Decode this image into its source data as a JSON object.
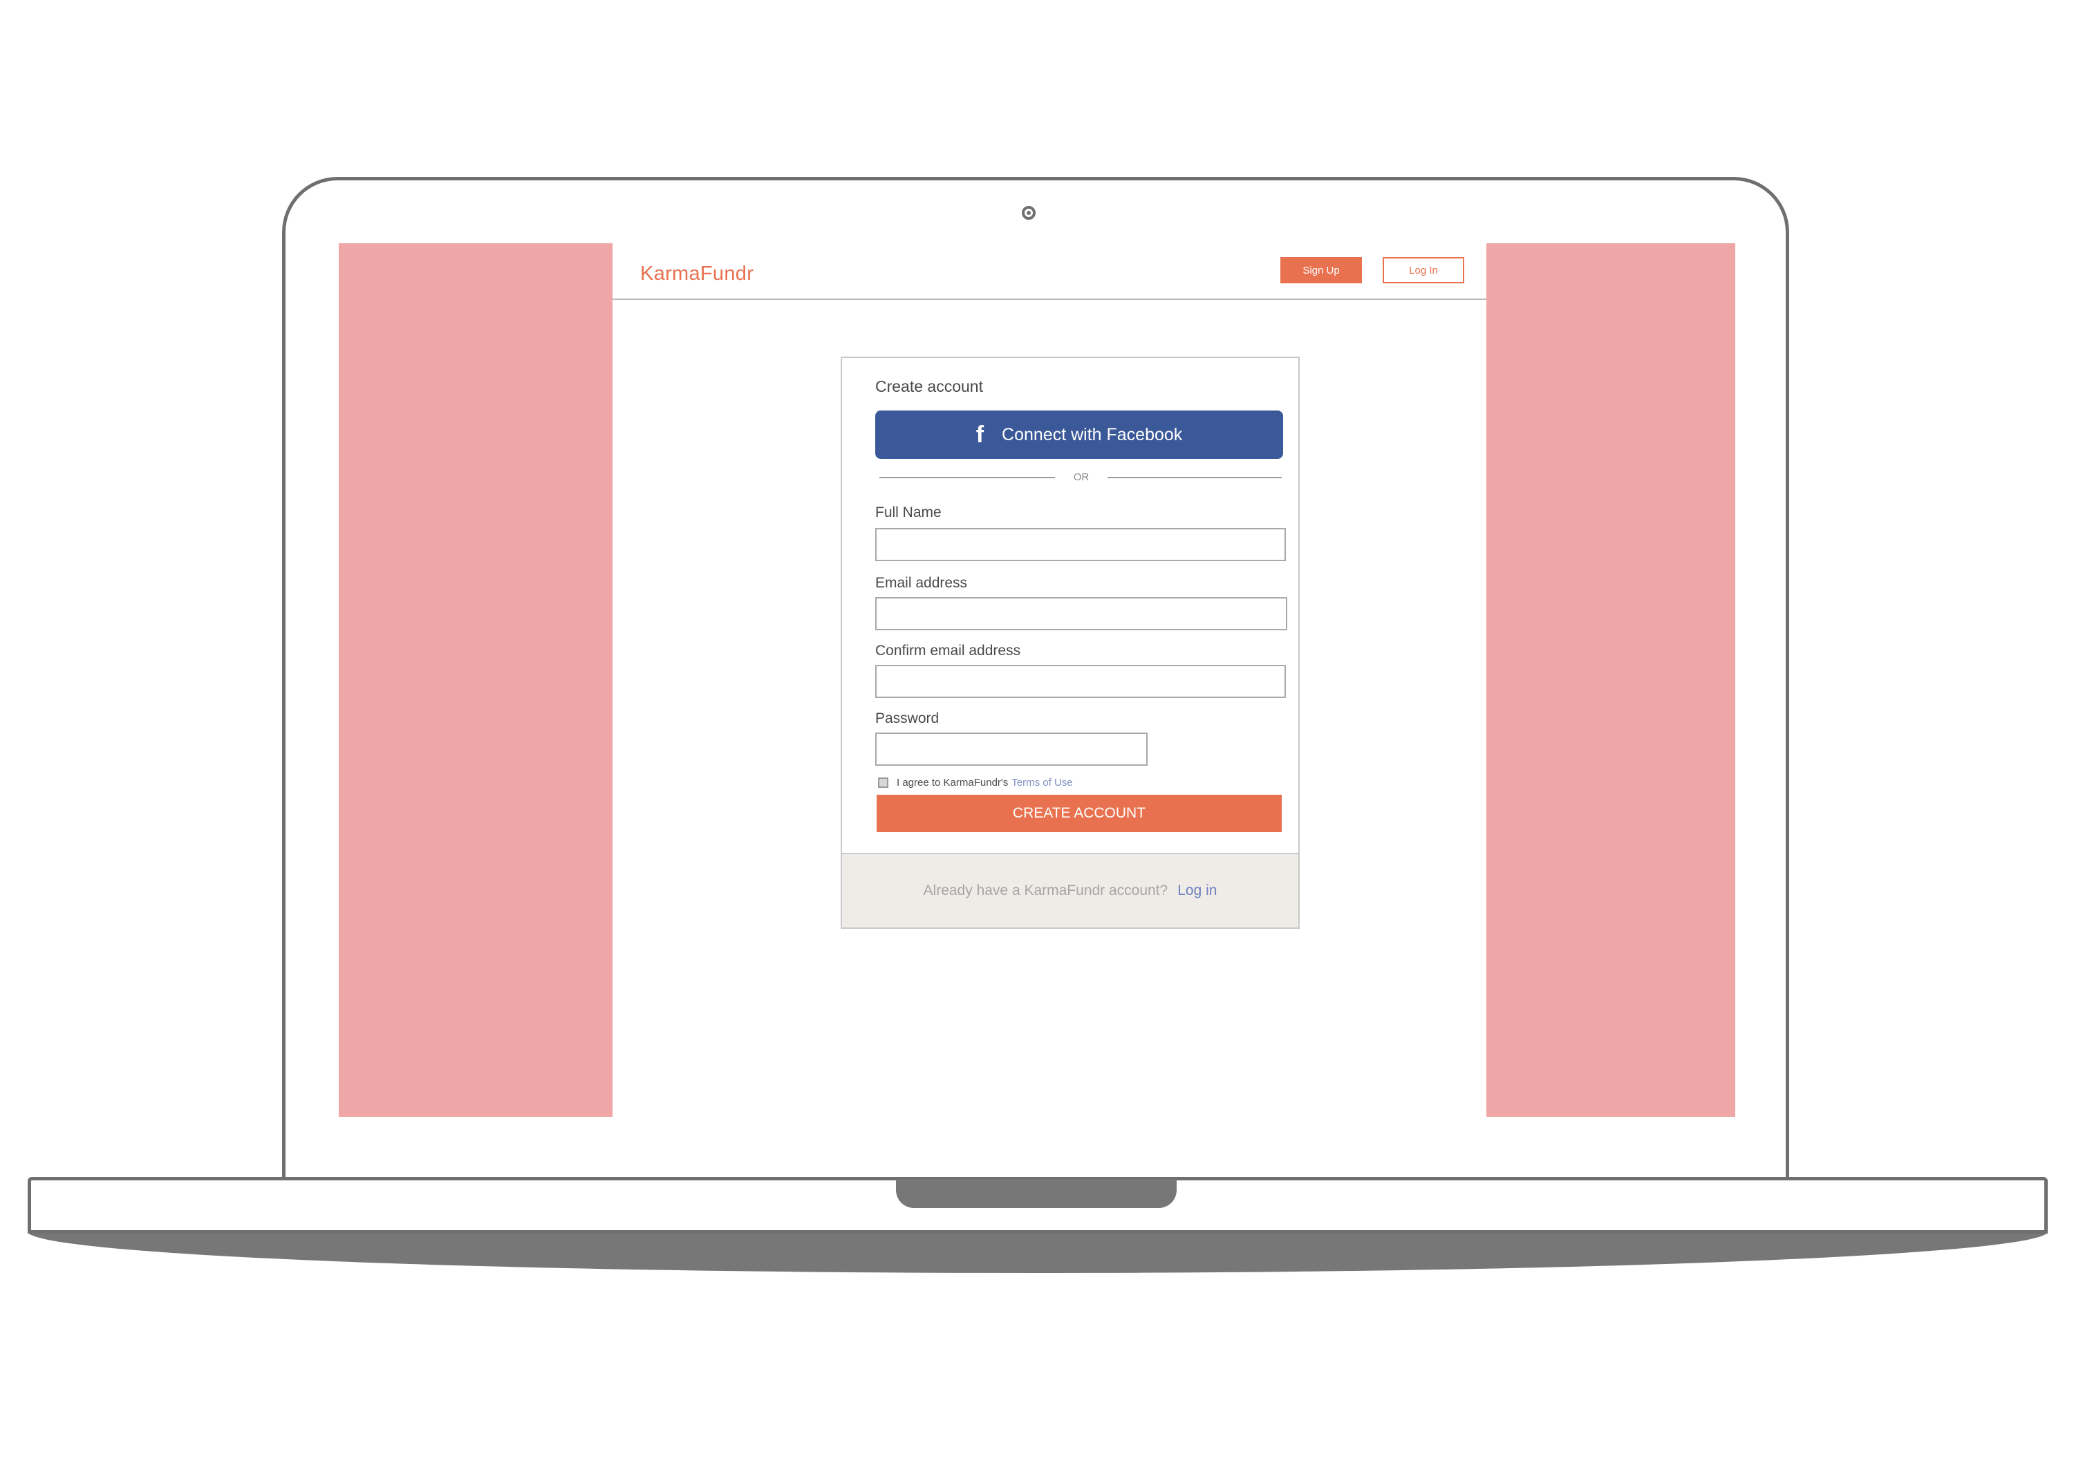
{
  "app": {
    "brand": "KarmaFundr",
    "accent_color": "#e8714f",
    "facebook_color": "#3b5998",
    "side_panel_color": "#eea6a6"
  },
  "header": {
    "signup_label": "Sign Up",
    "login_label": "Log In"
  },
  "form": {
    "title": "Create account",
    "facebook_icon": "facebook-f-icon",
    "facebook_label": "Connect with Facebook",
    "or_label": "OR",
    "full_name": {
      "label": "Full Name",
      "value": "",
      "placeholder": ""
    },
    "email": {
      "label": "Email address",
      "value": "",
      "placeholder": ""
    },
    "confirm_email": {
      "label": "Confirm email address",
      "value": "",
      "placeholder": ""
    },
    "password": {
      "label": "Password",
      "value": "",
      "placeholder": ""
    },
    "terms_checked": false,
    "terms_text": "I agree to KarmaFundr's",
    "terms_link": "Terms of Use",
    "submit_label": "CREATE ACCOUNT"
  },
  "footer": {
    "text": "Already have a KarmaFundr account?",
    "link": "Log in"
  }
}
